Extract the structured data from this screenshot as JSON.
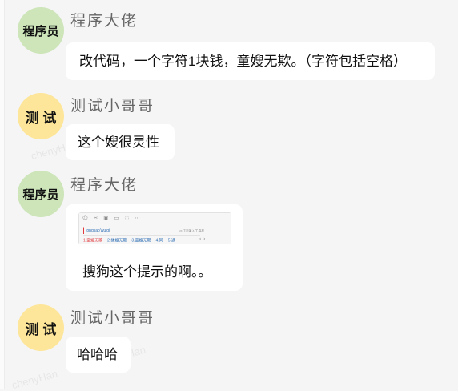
{
  "chat": {
    "watermark": "chenyHan",
    "colors": {
      "background": "#f5f5f5",
      "bubble": "#ffffff",
      "developer_avatar": "#cde5b9",
      "tester_avatar": "#fde699",
      "sender_name": "#666666",
      "ime_highlight": "#e0393e",
      "ime_pinyin": "#2b6cb3"
    }
  },
  "messages": [
    {
      "sender": "程序大佬",
      "avatar_text": "程序员",
      "avatar_color": "#cde5b9",
      "text": "改代码，一个字符1块钱，童嫂无欺。（字符包括空格）"
    },
    {
      "sender": "测试小哥哥",
      "avatar_text": "测 试",
      "avatar_color": "#fde699",
      "text": "这个嫂很灵性"
    },
    {
      "sender": "程序大佬",
      "avatar_text": "程序员",
      "avatar_color": "#cde5b9",
      "text": "搜狗这个提示的啊。。",
      "image": {
        "toolbar_icons": [
          "emoji-icon",
          "scissors-icon",
          "image-icon",
          "folder-icon",
          "chat-bubble-icon",
          "more-icon"
        ],
        "pinyin": "tongsao'wu'qi",
        "hint": "⊙打字输入工具栏",
        "candidates": [
          "1.童嫂无欺",
          "2.捅嫂无欺",
          "3.童嫂无期",
          "4.同",
          "5.通"
        ],
        "nav_icons": [
          "chevron-left-icon",
          "chevron-right-icon"
        ]
      }
    },
    {
      "sender": "测试小哥哥",
      "avatar_text": "测 试",
      "avatar_color": "#fde699",
      "text": "哈哈哈"
    }
  ]
}
